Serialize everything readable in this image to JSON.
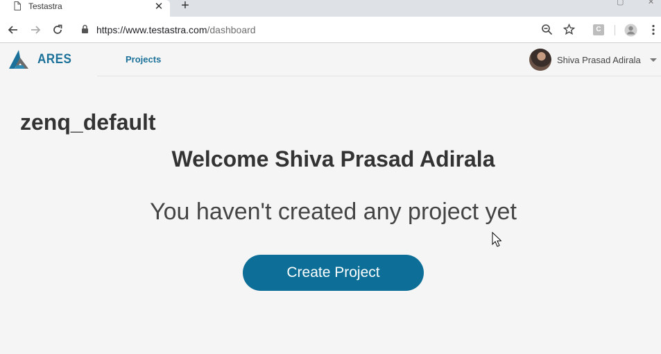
{
  "browser": {
    "tab_title": "Testastra",
    "url_host": "https://www.testastra.com",
    "url_path": "/dashboard",
    "extension_label": "C"
  },
  "app": {
    "logo_text": "ARES",
    "nav_projects": "Projects",
    "user_name": "Shiva Prasad Adirala"
  },
  "main": {
    "org_name": "zenq_default",
    "welcome": "Welcome Shiva Prasad Adirala",
    "empty_message": "You haven't created any project yet",
    "create_button": "Create Project"
  },
  "colors": {
    "brand": "#1b7199",
    "button": "#0d6f97",
    "background": "#f5f5f5"
  }
}
